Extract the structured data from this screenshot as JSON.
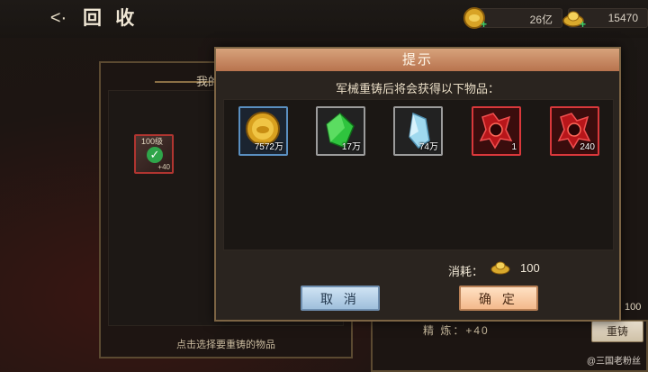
{
  "header": {
    "back_icon": "back-arrow-icon",
    "title": "回 收",
    "currencies": [
      {
        "icon": "gold-coin-icon",
        "value": "26亿"
      },
      {
        "icon": "gold-ingot-icon",
        "value": "15470"
      }
    ]
  },
  "left_panel": {
    "header_text": "我的",
    "slot": {
      "level": "100级",
      "bonus": "+40"
    },
    "hint": "点击选择要重铸的物品"
  },
  "right_panel": {
    "refine_text": "精 炼：+40",
    "side_value": "100",
    "recast_button": "重铸"
  },
  "modal": {
    "title": "提示",
    "subtitle": "军械重铸后将会获得以下物品：",
    "items": [
      {
        "name": "gold-coin",
        "count": "7572万",
        "frame": "blue"
      },
      {
        "name": "green-gem",
        "count": "17万",
        "frame": "gray"
      },
      {
        "name": "blue-crystal",
        "count": "74万",
        "frame": "gray"
      },
      {
        "name": "red-token",
        "count": "1",
        "frame": "red"
      },
      {
        "name": "red-token",
        "count": "240",
        "frame": "red"
      }
    ],
    "cost_label": "消耗：",
    "cost_icon": "gold-ingot-icon",
    "cost_value": "100",
    "cancel_label": "取 消",
    "confirm_label": "确 定"
  },
  "watermark": "@三国老粉丝",
  "colors": {
    "title_bar": "#c9855e",
    "cancel_button": "#b7d2ea",
    "confirm_button": "#f7c9a0",
    "frame_red": "#d9383b",
    "frame_blue": "#5a8fc0"
  }
}
